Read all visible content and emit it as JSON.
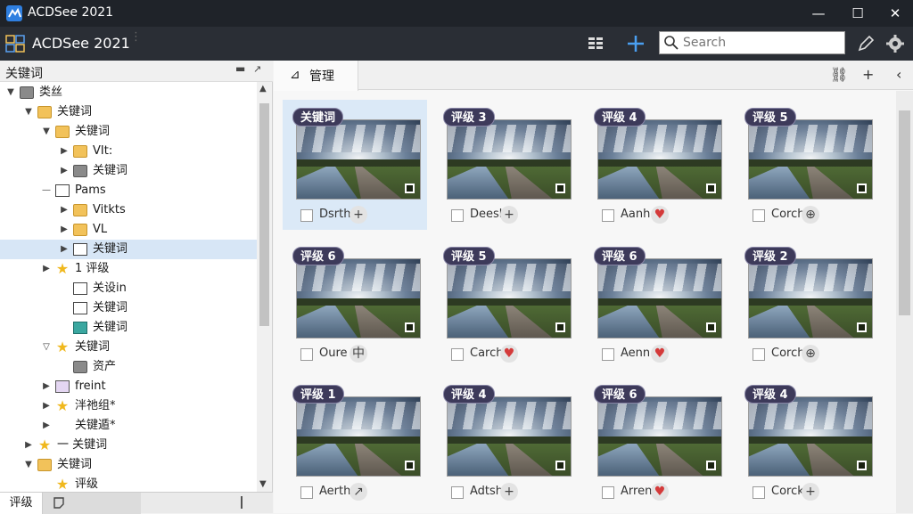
{
  "window": {
    "title": "ACDSee 2021",
    "minimize": "—",
    "maximize": "☐",
    "close": "✕"
  },
  "toolbar": {
    "app_name": "ACDSee 2021",
    "drag_handle": "⋮",
    "search_placeholder": "Search",
    "search_value": ""
  },
  "left_panel": {
    "title": "关键词",
    "pin": "▬",
    "pin2": "↗",
    "bottom_tab": "评级",
    "tree": [
      {
        "label": "类丝",
        "indent": 0,
        "expander": "▼",
        "icon": "folder-grey"
      },
      {
        "label": "关键词",
        "indent": 1,
        "expander": "▼",
        "icon": "folder"
      },
      {
        "label": "关键词",
        "indent": 2,
        "expander": "▼",
        "icon": "folder"
      },
      {
        "label": "VIt:",
        "indent": 3,
        "expander": "▶",
        "icon": "folder"
      },
      {
        "label": "关键词",
        "indent": 3,
        "expander": "▶",
        "icon": "folder-grey"
      },
      {
        "label": "Pams",
        "indent": 2,
        "expander": "—",
        "icon": "folder-line"
      },
      {
        "label": "Vitkts",
        "indent": 3,
        "expander": "▶",
        "icon": "folder"
      },
      {
        "label": "VL",
        "indent": 3,
        "expander": "▶",
        "icon": "folder"
      },
      {
        "label": "关键词",
        "indent": 3,
        "expander": "▶",
        "icon": "folder-line",
        "selected": true
      },
      {
        "label": "1 评级",
        "indent": 2,
        "expander": "▶",
        "icon": "star"
      },
      {
        "label": "关设in",
        "indent": 3,
        "expander": "",
        "icon": "folder-line"
      },
      {
        "label": "关键词",
        "indent": 3,
        "expander": "",
        "icon": "folder-line"
      },
      {
        "label": "关键词",
        "indent": 3,
        "expander": "",
        "icon": "folder-teal"
      },
      {
        "label": "关键词",
        "indent": 2,
        "expander": "▽",
        "icon": "star"
      },
      {
        "label": "资产",
        "indent": 3,
        "expander": "",
        "icon": "folder-grey"
      },
      {
        "label": "freint",
        "indent": 2,
        "expander": "▶",
        "icon": "folder-purple"
      },
      {
        "label": "泮祂组*",
        "indent": 2,
        "expander": "▶",
        "icon": "star"
      },
      {
        "label": "关键遁*",
        "indent": 2,
        "expander": "▶",
        "icon": "none"
      },
      {
        "label": "一 关键词",
        "indent": 1,
        "expander": "▶",
        "icon": "star"
      },
      {
        "label": "关键词",
        "indent": 1,
        "expander": "▼",
        "icon": "folder"
      },
      {
        "label": "评级",
        "indent": 2,
        "expander": "",
        "icon": "star"
      }
    ]
  },
  "right_panel": {
    "tab_label": "管理",
    "tab_icon": "⊿",
    "link_icon": "⛓",
    "add_icon": "+",
    "collapse_icon": "‹",
    "cards": [
      {
        "badge": "关键词",
        "name": "Dsrth",
        "action": "+",
        "heart": false,
        "selected": true
      },
      {
        "badge": "评级 3",
        "name": "Deesh",
        "action": "+",
        "heart": false
      },
      {
        "badge": "评级 4",
        "name": "Aanh",
        "action": "♥",
        "heart": true
      },
      {
        "badge": "评级 5",
        "name": "Corch",
        "action": "⊕",
        "heart": false
      },
      {
        "badge": "评级 6",
        "name": "Oure",
        "action": "中",
        "heart": false
      },
      {
        "badge": "评级 5",
        "name": "Carch",
        "action": "♥",
        "heart": true
      },
      {
        "badge": "评级 6",
        "name": "Aenn",
        "action": "♥",
        "heart": true
      },
      {
        "badge": "评级 2",
        "name": "Corch",
        "action": "⊕",
        "heart": false
      },
      {
        "badge": "评级 1",
        "name": "Aerth",
        "action": "↗",
        "heart": false
      },
      {
        "badge": "评级 4",
        "name": "Adtsh",
        "action": "+",
        "heart": false
      },
      {
        "badge": "评级 6",
        "name": "Arren",
        "action": "♥",
        "heart": true
      },
      {
        "badge": "评级 4",
        "name": "Corck",
        "action": "+",
        "heart": false
      }
    ]
  },
  "colors": {
    "titlebar": "#1f2329",
    "toolbar": "#2a2e35",
    "accent": "#2f7fe0",
    "badge": "#3d3a5a",
    "selection": "#d7e6f6"
  }
}
